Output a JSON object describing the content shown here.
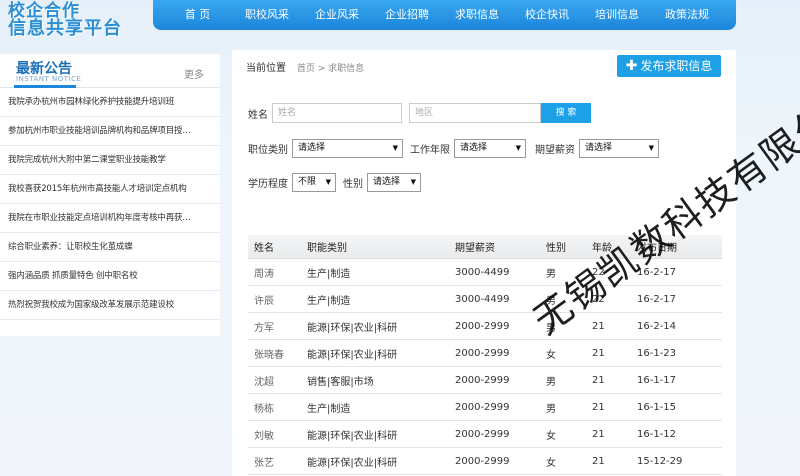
{
  "logo": {
    "line1": "校企合作",
    "line2": "信息共享平台"
  },
  "nav": {
    "items": [
      "首 页",
      "职校风采",
      "企业风采",
      "企业招聘",
      "求职信息",
      "校企快讯",
      "培训信息",
      "政策法规"
    ]
  },
  "sidebar": {
    "title": "最新公告",
    "subtitle": "INSTANT NOTICE",
    "more": "更多",
    "items": [
      "我院承办杭州市园林绿化养护技能提升培训班",
      "参加杭州市职业技能培训品牌机构和品牌项目授…",
      "我院完成杭州大附中第二课堂职业技能教学",
      "我校喜获2015年杭州市高技能人才培训定点机构",
      "我院在市职业技能定点培训机构年度考核中再获…",
      "综合职业素养：让职校生化茧成蝶",
      "强内涵品质 抓质量特色 创中职名校",
      "热烈祝贺我校成为国家级改革发展示范建设校"
    ]
  },
  "breadcrumb": {
    "label": "当前位置",
    "path": "首页 > 求职信息"
  },
  "publish_button": "发布求职信息",
  "search": {
    "name_label": "姓名",
    "name_placeholder": "姓名",
    "area_placeholder": "地区",
    "search_button": "搜 索",
    "job_type_label": "职位类别",
    "job_type_value": "请选择",
    "work_years_label": "工作年限",
    "work_years_value": "请选择",
    "salary_label": "期望薪资",
    "salary_value": "请选择",
    "education_label": "学历程度",
    "education_value": "不限",
    "gender_label": "性别",
    "gender_value": "请选择"
  },
  "table": {
    "headers": [
      "姓名",
      "职能类别",
      "期望薪资",
      "性别",
      "年龄",
      "发布日期"
    ],
    "rows": [
      [
        "周涛",
        "生产|制造",
        "3000-4499",
        "男",
        "22",
        "16-2-17"
      ],
      [
        "许辰",
        "生产|制造",
        "3000-4499",
        "男",
        "22",
        "16-2-17"
      ],
      [
        "方军",
        "能源|环保|农业|科研",
        "2000-2999",
        "男",
        "21",
        "16-2-14"
      ],
      [
        "张晓春",
        "能源|环保|农业|科研",
        "2000-2999",
        "女",
        "21",
        "16-1-23"
      ],
      [
        "沈超",
        "销售|客服|市场",
        "2000-2999",
        "男",
        "21",
        "16-1-17"
      ],
      [
        "杨栋",
        "生产|制造",
        "2000-2999",
        "男",
        "21",
        "16-1-15"
      ],
      [
        "刘敏",
        "能源|环保|农业|科研",
        "2000-2999",
        "女",
        "21",
        "16-1-12"
      ],
      [
        "张艺",
        "能源|环保|农业|科研",
        "2000-2999",
        "女",
        "21",
        "15-12-29"
      ]
    ]
  },
  "watermark": "无锡凯数科技有限公司"
}
